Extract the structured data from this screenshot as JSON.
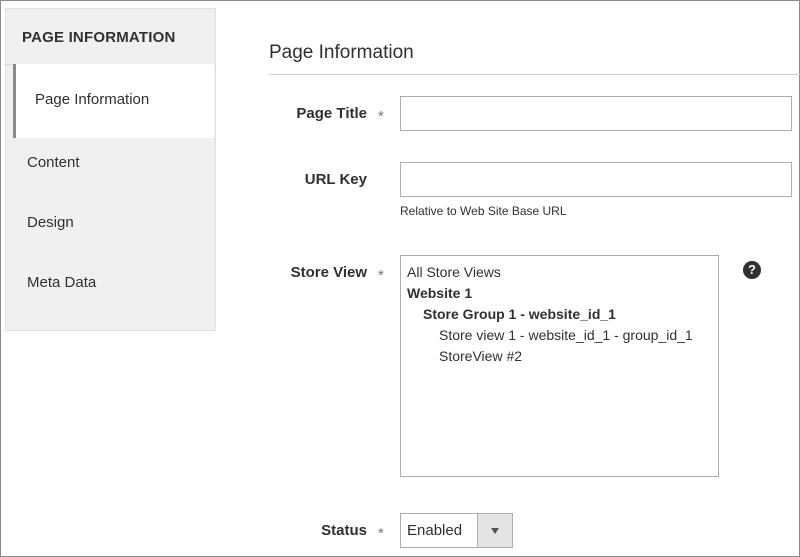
{
  "sidebar": {
    "header": "PAGE INFORMATION",
    "items": [
      {
        "label": "Page Information"
      },
      {
        "label": "Content"
      },
      {
        "label": "Design"
      },
      {
        "label": "Meta Data"
      }
    ]
  },
  "section": {
    "title": "Page Information"
  },
  "form": {
    "page_title": {
      "label": "Page Title",
      "required": "*",
      "value": ""
    },
    "url_key": {
      "label": "URL Key",
      "value": "",
      "note": "Relative to Web Site Base URL"
    },
    "store_view": {
      "label": "Store View",
      "required": "*",
      "options": [
        {
          "label": "All Store Views"
        },
        {
          "label": "Website 1"
        },
        {
          "label": "Store Group 1 - website_id_1"
        },
        {
          "label": "Store view 1 - website_id_1 - group_id_1"
        },
        {
          "label": "StoreView #2"
        }
      ],
      "help_icon": "?"
    },
    "status": {
      "label": "Status",
      "required": "*",
      "value": "Enabled"
    }
  },
  "icons": {
    "help": "question-circle-icon",
    "dropdown": "caret-down-icon"
  }
}
